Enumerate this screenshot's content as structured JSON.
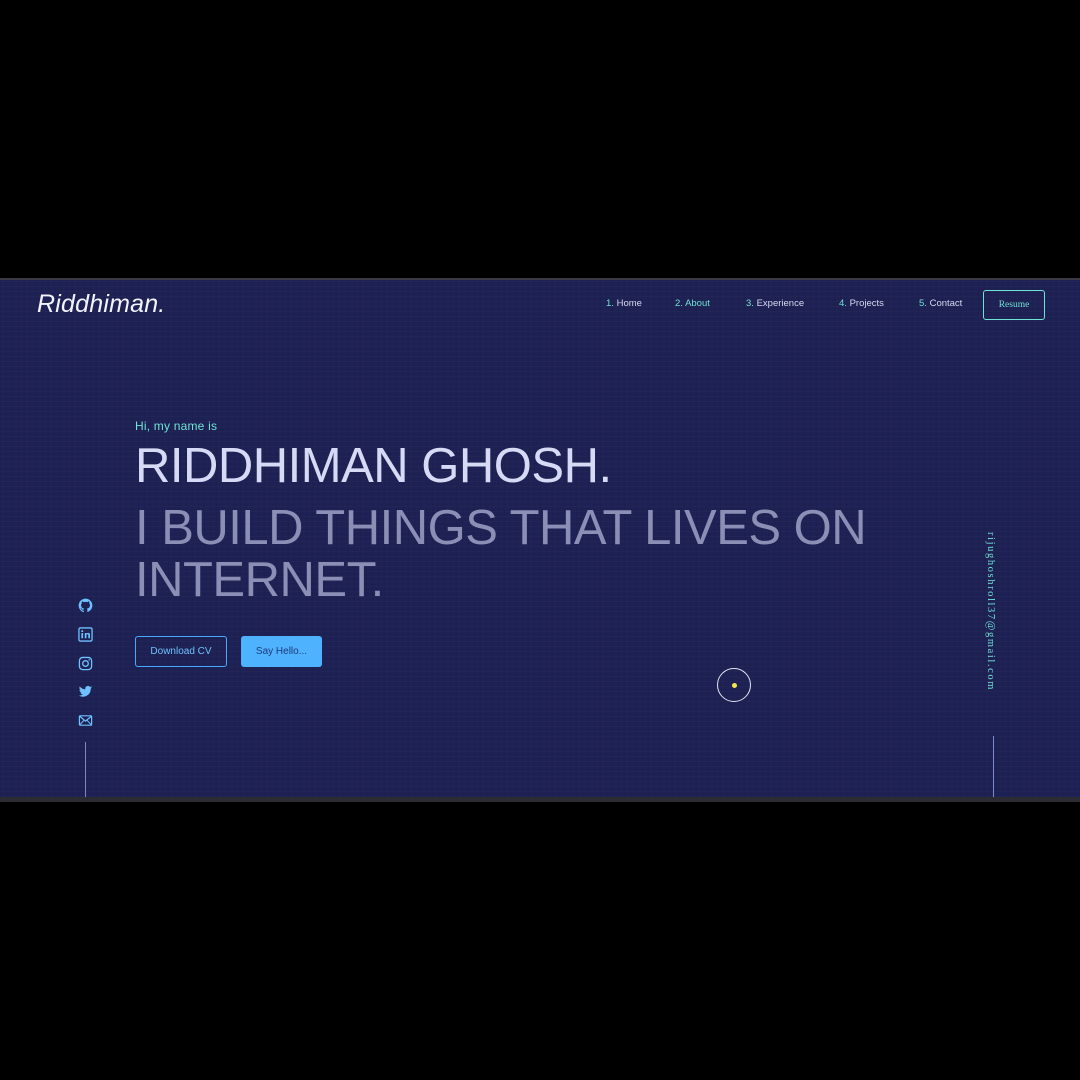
{
  "header": {
    "logo": "Riddhiman."
  },
  "nav": {
    "items": [
      {
        "num": "1.",
        "label": "Home"
      },
      {
        "num": "2.",
        "label": "About"
      },
      {
        "num": "3.",
        "label": "Experience"
      },
      {
        "num": "4.",
        "label": "Projects"
      },
      {
        "num": "5.",
        "label": "Contact"
      }
    ],
    "resume_label": "Resume"
  },
  "hero": {
    "greeting": "Hi, my name is",
    "name": "RIDDHIMAN GHOSH.",
    "tagline": "I BUILD THINGS THAT LIVES ON INTERNET.",
    "download_cv_label": "Download CV",
    "say_hello_label": "Say Hello..."
  },
  "social": {
    "icons": [
      "github-icon",
      "linkedin-icon",
      "instagram-icon",
      "twitter-icon",
      "mail-icon"
    ]
  },
  "email": {
    "address": "rijughoshroll37@gmail.com"
  },
  "colors": {
    "background": "#1e2153",
    "accent_teal": "#6fe3d4",
    "accent_blue": "#4fb2ff",
    "heading": "#d6daf4",
    "subheading": "#8b8fb5",
    "cursor_dot": "#f3e64a"
  }
}
